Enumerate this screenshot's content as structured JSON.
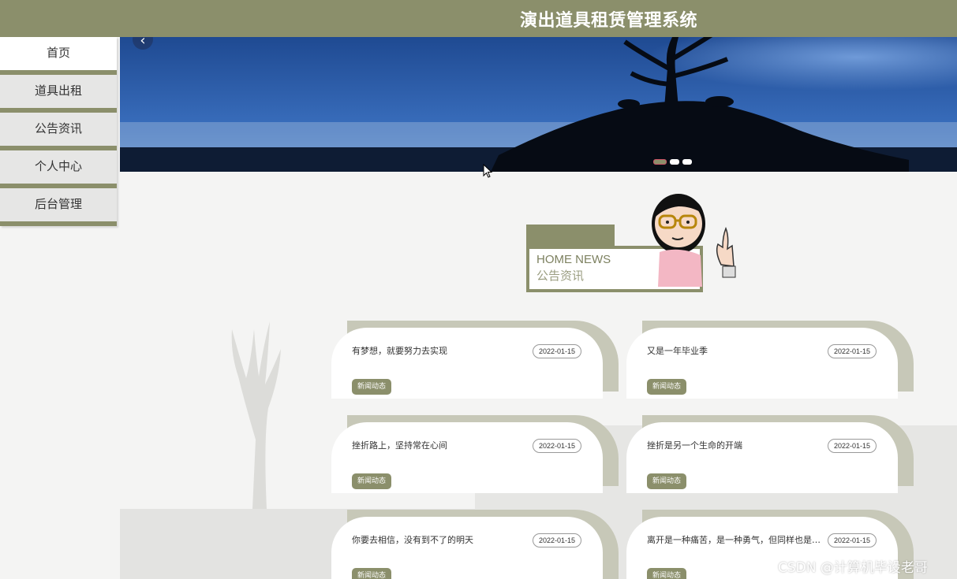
{
  "header": {
    "title": "演出道具租赁管理系统"
  },
  "sidebar": {
    "items": [
      {
        "label": "首页",
        "active": true
      },
      {
        "label": "道具出租",
        "active": false
      },
      {
        "label": "公告资讯",
        "active": false
      },
      {
        "label": "个人中心",
        "active": false
      },
      {
        "label": "后台管理",
        "active": false
      }
    ]
  },
  "carousel": {
    "prev_symbol": "‹",
    "slide_count": 3,
    "active_index": 0
  },
  "news_section": {
    "heading_en": "HOME NEWS",
    "heading_cn": "公告资讯"
  },
  "news": [
    {
      "title": "有梦想，就要努力去实现",
      "date": "2022-01-15",
      "tag": "新闻动态"
    },
    {
      "title": "又是一年毕业季",
      "date": "2022-01-15",
      "tag": "新闻动态"
    },
    {
      "title": "挫折路上，坚持常在心间",
      "date": "2022-01-15",
      "tag": "新闻动态"
    },
    {
      "title": "挫折是另一个生命的开端",
      "date": "2022-01-15",
      "tag": "新闻动态"
    },
    {
      "title": "你要去相信，没有到不了的明天",
      "date": "2022-01-15",
      "tag": "新闻动态"
    },
    {
      "title": "离开是一种痛苦，是一种勇气，但同样也是一…",
      "date": "2022-01-15",
      "tag": "新闻动态"
    }
  ],
  "watermark": "CSDN @计算机毕设老哥",
  "colors": {
    "accent": "#8b8f6b",
    "card_shade": "#c7c8b8",
    "sidebar_bg": "#e6e6e5"
  }
}
